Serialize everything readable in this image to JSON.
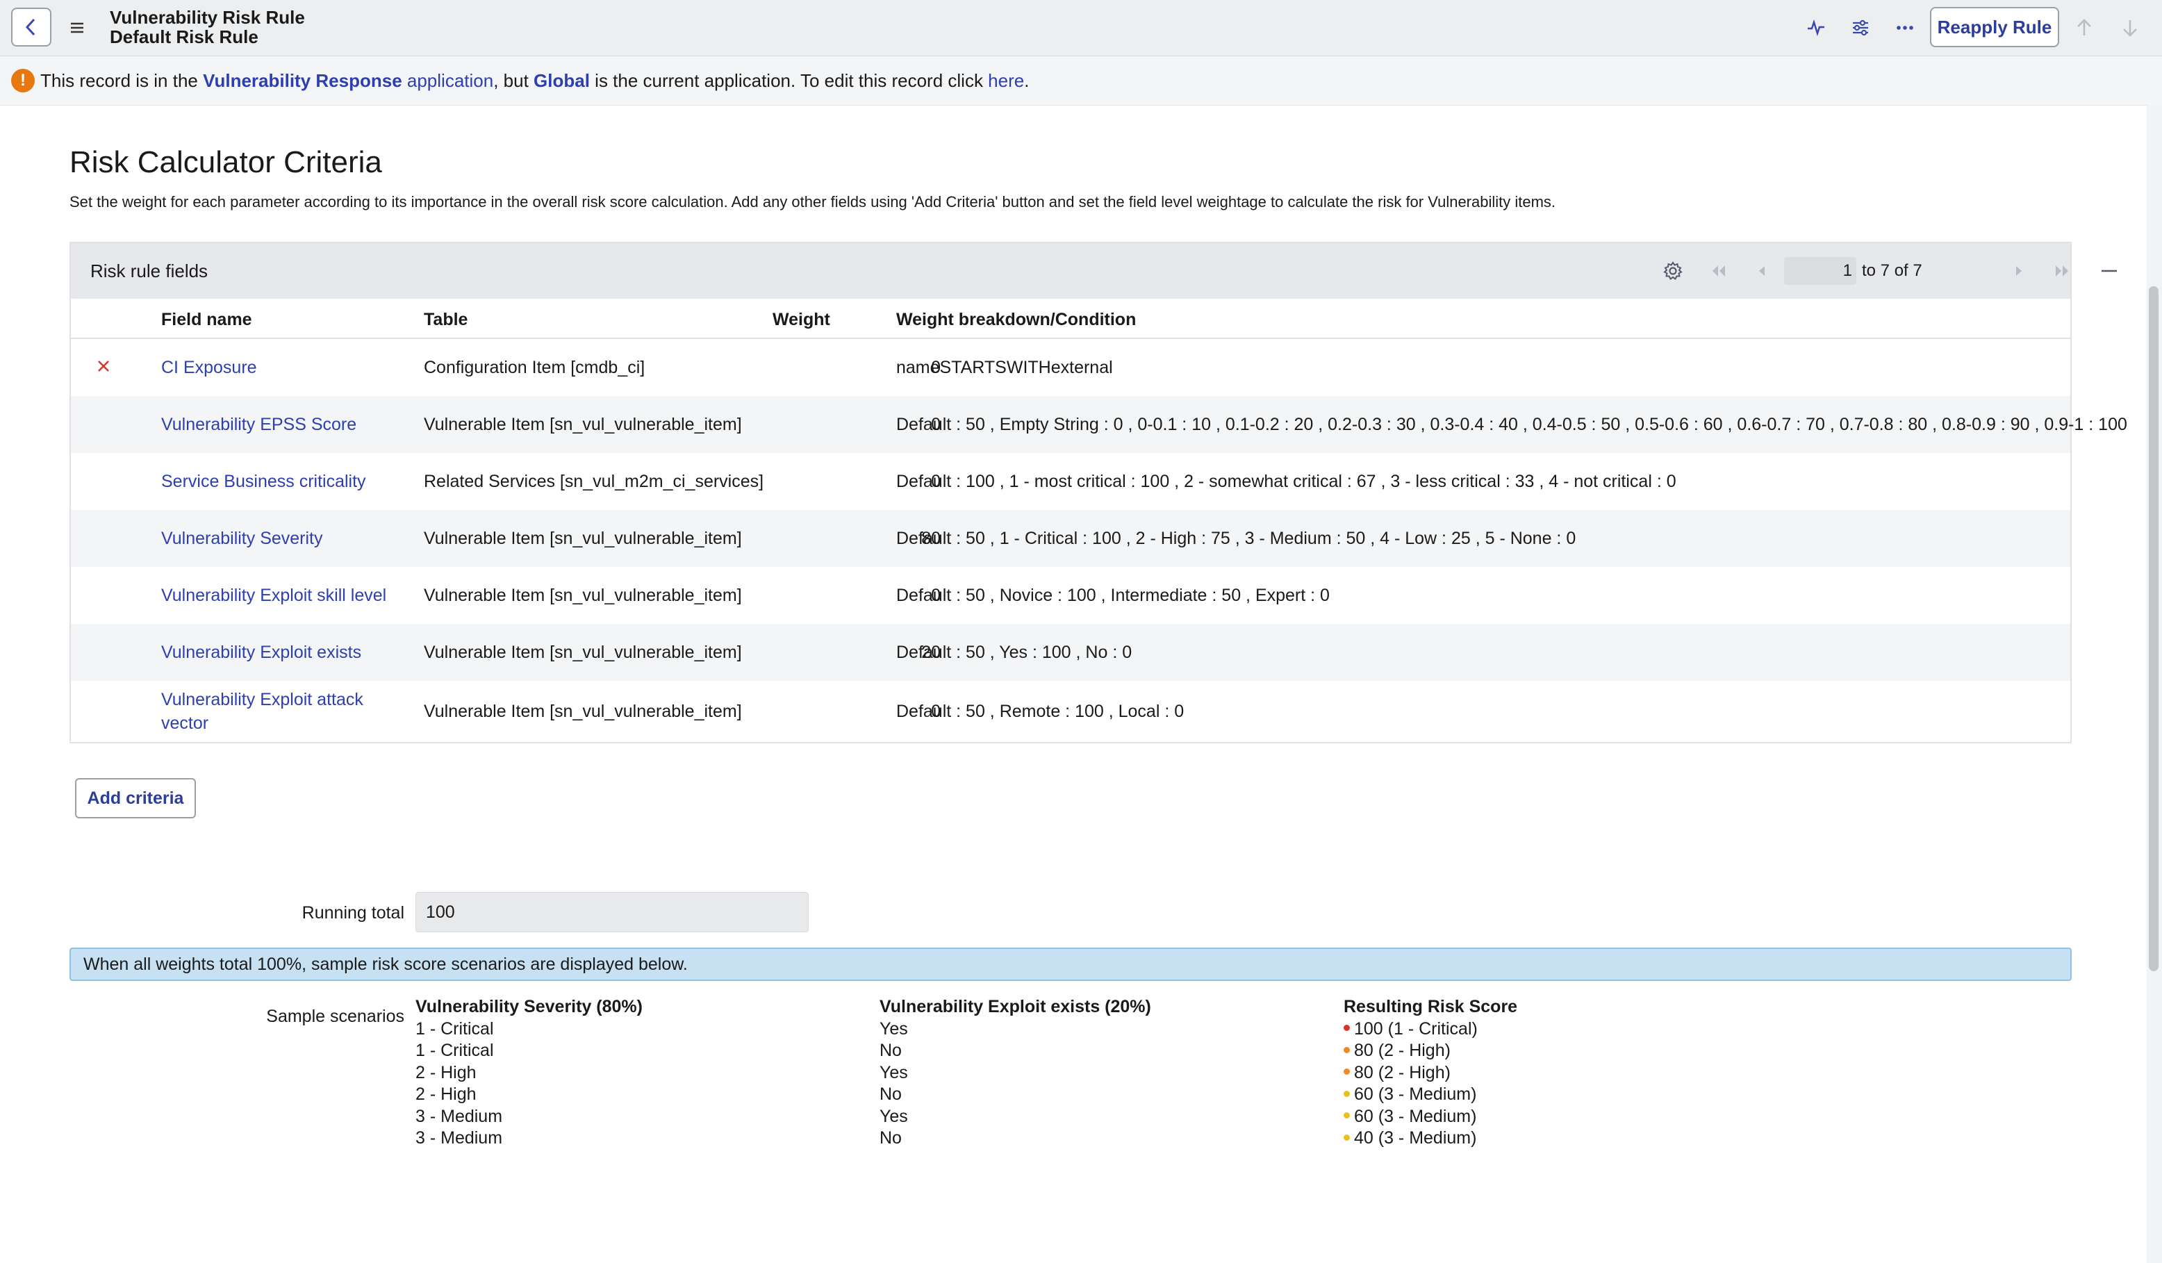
{
  "header": {
    "title_line1": "Vulnerability Risk Rule",
    "title_line2": "Default Risk Rule",
    "reapply_label": "Reapply Rule",
    "icons": [
      "back-chevron-icon",
      "hamburger-menu-icon",
      "activity-pulse-icon",
      "sliders-icon",
      "more-dots-icon",
      "arrow-up-icon",
      "arrow-down-icon"
    ]
  },
  "infobar": {
    "part1": "This record is in the ",
    "app_name": "Vulnerability Response",
    "app_word": " application",
    "part2": ", but ",
    "global": "Global",
    "part3": " is the current application. To edit this record click ",
    "here": "here",
    "end": "."
  },
  "page": {
    "title": "Risk Calculator Criteria",
    "description": "Set the weight for each parameter according to its importance in the overall risk score calculation. Add any other fields using 'Add Criteria' button and set the field level weightage to calculate the risk for Vulnerability items."
  },
  "table": {
    "label": "Risk rule fields",
    "pagination": {
      "current": "1",
      "range_text": "to 7 of 7"
    },
    "columns": [
      "Field name",
      "Table",
      "Weight",
      "Weight breakdown/Condition"
    ],
    "rows": [
      {
        "field": "CI Exposure",
        "table": "Configuration Item [cmdb_ci]",
        "weight": "0",
        "condition": "nameSTARTSWITHexternal"
      },
      {
        "field": "Vulnerability EPSS Score",
        "table": "Vulnerable Item [sn_vul_vulnerable_item]",
        "weight": "0",
        "condition": "Default : 50 , Empty String : 0 , 0-0.1 : 10 , 0.1-0.2 : 20 , 0.2-0.3 : 30 , 0.3-0.4 : 40 , 0.4-0.5 : 50 , 0.5-0.6 : 60 , 0.6-0.7 : 70 , 0.7-0.8 : 80 , 0.8-0.9 : 90 , 0.9-1 : 100"
      },
      {
        "field": "Service Business criticality",
        "table": "Related Services [sn_vul_m2m_ci_services]",
        "weight": "0",
        "condition": "Default : 100 , 1 - most critical : 100 , 2 - somewhat critical : 67 , 3 - less critical : 33 , 4 - not critical : 0"
      },
      {
        "field": "Vulnerability Severity",
        "table": "Vulnerable Item [sn_vul_vulnerable_item]",
        "weight": "80",
        "condition": "Default : 50 , 1 - Critical : 100 , 2 - High : 75 , 3 - Medium : 50 , 4 - Low : 25 , 5 - None : 0"
      },
      {
        "field": "Vulnerability Exploit skill level",
        "table": "Vulnerable Item [sn_vul_vulnerable_item]",
        "weight": "0",
        "condition": "Default : 50 , Novice : 100 , Intermediate : 50 , Expert : 0"
      },
      {
        "field": "Vulnerability Exploit exists",
        "table": "Vulnerable Item [sn_vul_vulnerable_item]",
        "weight": "20",
        "condition": "Default : 50 , Yes : 100 , No : 0"
      },
      {
        "field_line1": "Vulnerability Exploit attack",
        "field_line2": "vector",
        "table": "Vulnerable Item [sn_vul_vulnerable_item]",
        "weight": "0",
        "condition": "Default : 50 , Remote : 100 , Local : 0"
      }
    ]
  },
  "add_criteria_label": "Add criteria",
  "running_total": {
    "label": "Running total",
    "value": "100"
  },
  "note": "When all weights total 100%, sample risk score scenarios are displayed below.",
  "samples": {
    "label": "Sample scenarios",
    "col1": {
      "header": "Vulnerability Severity (80%)",
      "values": [
        "1 - Critical",
        "1 - Critical",
        "2 - High",
        "2 - High",
        "3 - Medium",
        "3 - Medium"
      ]
    },
    "col2": {
      "header": "Vulnerability Exploit exists (20%)",
      "values": [
        "Yes",
        "No",
        "Yes",
        "No",
        "Yes",
        "No"
      ]
    },
    "col3": {
      "header": "Resulting Risk Score",
      "values": [
        "100 (1 - Critical)",
        "80 (2 - High)",
        "80 (2 - High)",
        "60 (3 - Medium)",
        "60 (3 - Medium)",
        "40 (3 - Medium)"
      ]
    },
    "dot_colors": [
      "#d9342b",
      "#f08a24",
      "#f08a24",
      "#e8c21a",
      "#e8c21a",
      "#e8c21a"
    ]
  },
  "colors": {
    "link": "#2d3fb0",
    "warning": "#e7780f",
    "note_bg": "#c7e1f3",
    "delete_x": "#d9342b"
  }
}
